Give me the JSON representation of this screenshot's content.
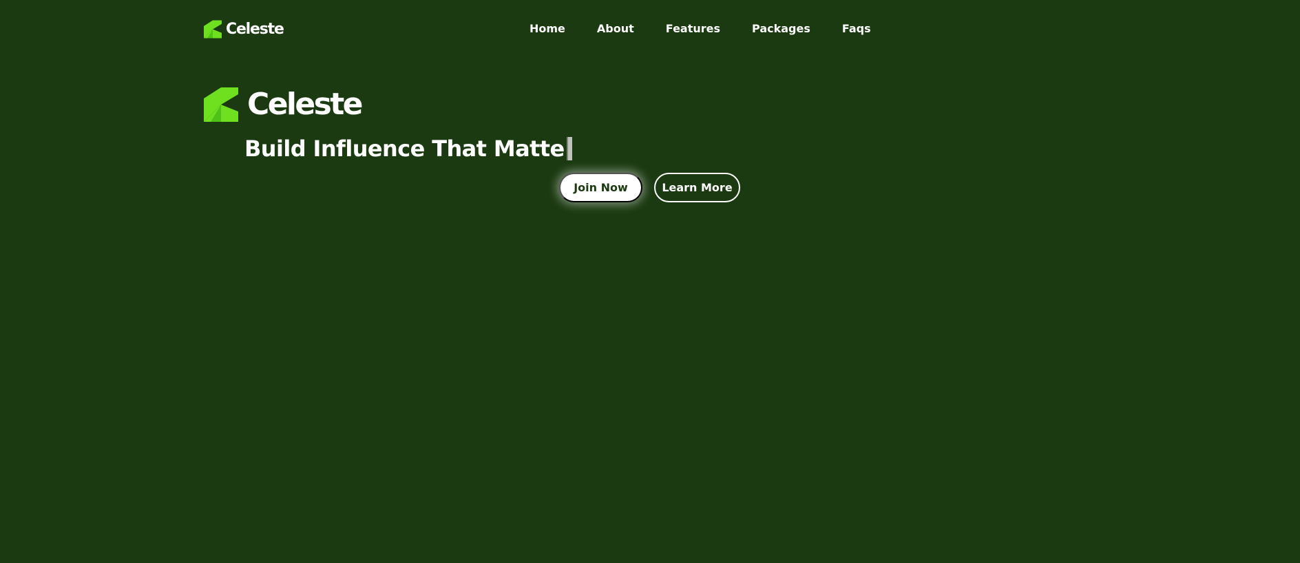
{
  "nav": {
    "brand": "Celeste",
    "links": [
      "Home",
      "About",
      "Features",
      "Packages",
      "Faqs"
    ]
  },
  "hero": {
    "brand": "Celeste",
    "headline": "Build Influence That Matte",
    "primary_button": "Join Now",
    "secondary_button": "Learn More"
  },
  "theme": {
    "background": "#1b3a11",
    "logo_green": "#6fe01f",
    "text": "#ffffff"
  },
  "icons": {
    "logo": "celeste-logo-icon",
    "caret": "text-cursor-icon"
  }
}
